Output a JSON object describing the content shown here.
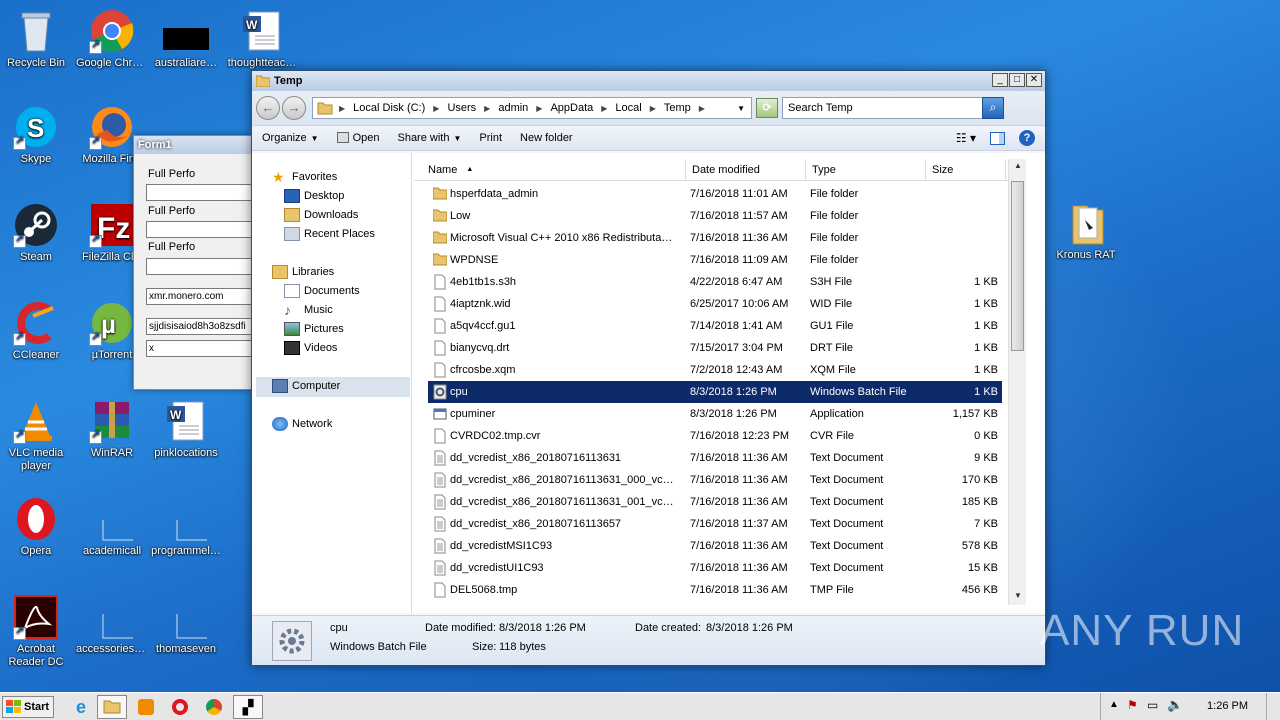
{
  "desktop": {
    "icons": [
      {
        "label": "Recycle Bin"
      },
      {
        "label": "Google Chrome"
      },
      {
        "label": "australiare…"
      },
      {
        "label": "thoughtteac…"
      },
      {
        "label": "Skype"
      },
      {
        "label": "Mozilla Firef"
      },
      {
        "label": "Steam"
      },
      {
        "label": "FileZilla Clie"
      },
      {
        "label": "CCleaner"
      },
      {
        "label": "µTorrent"
      },
      {
        "label": "VLC media player"
      },
      {
        "label": "WinRAR"
      },
      {
        "label": "pinklocations"
      },
      {
        "label": "Opera"
      },
      {
        "label": "academicall"
      },
      {
        "label": "programmel…"
      },
      {
        "label": "Acrobat Reader DC"
      },
      {
        "label": "accessoriesr…"
      },
      {
        "label": "thomaseven"
      },
      {
        "label": "Kronus RAT"
      }
    ]
  },
  "form1": {
    "title": "Form1",
    "labels": [
      "Full Perfo",
      "Full Perfo",
      "Full Perfo"
    ],
    "inputs": [
      "",
      "",
      "",
      "xmr.monero.com",
      "sjjdisisaiod8h3o8zsdfi",
      "x"
    ]
  },
  "explorer": {
    "title": "Temp",
    "breadcrumbs": [
      "Local Disk (C:)",
      "Users",
      "admin",
      "AppData",
      "Local",
      "Temp"
    ],
    "search_placeholder": "Search Temp",
    "commands": [
      "Organize",
      "Open",
      "Share with",
      "Print",
      "New folder"
    ],
    "nav": {
      "favorites": "Favorites",
      "desktop": "Desktop",
      "downloads": "Downloads",
      "recent": "Recent Places",
      "libraries": "Libraries",
      "documents": "Documents",
      "music": "Music",
      "pictures": "Pictures",
      "videos": "Videos",
      "computer": "Computer",
      "network": "Network"
    },
    "columns": {
      "name": "Name",
      "date": "Date modified",
      "type": "Type",
      "size": "Size"
    },
    "files": [
      {
        "name": "hsperfdata_admin",
        "date": "7/16/2018 11:01 AM",
        "type": "File folder",
        "size": "",
        "kind": "folder"
      },
      {
        "name": "Low",
        "date": "7/16/2018 11:57 AM",
        "type": "File folder",
        "size": "",
        "kind": "folder"
      },
      {
        "name": "Microsoft Visual C++ 2010  x86 Redistributa…",
        "date": "7/16/2018 11:36 AM",
        "type": "File folder",
        "size": "",
        "kind": "folder"
      },
      {
        "name": "WPDNSE",
        "date": "7/16/2018 11:09 AM",
        "type": "File folder",
        "size": "",
        "kind": "folder"
      },
      {
        "name": "4eb1tb1s.s3h",
        "date": "4/22/2018 6:47 AM",
        "type": "S3H File",
        "size": "1 KB",
        "kind": "file"
      },
      {
        "name": "4iaptznk.wid",
        "date": "6/25/2017 10:06 AM",
        "type": "WID File",
        "size": "1 KB",
        "kind": "file"
      },
      {
        "name": "a5qv4ccf.gu1",
        "date": "7/14/2018 1:41 AM",
        "type": "GU1 File",
        "size": "1 KB",
        "kind": "file"
      },
      {
        "name": "bianycvq.drt",
        "date": "7/15/2017 3:04 PM",
        "type": "DRT File",
        "size": "1 KB",
        "kind": "file"
      },
      {
        "name": "cfrcosbe.xqm",
        "date": "7/2/2018 12:43 AM",
        "type": "XQM File",
        "size": "1 KB",
        "kind": "file"
      },
      {
        "name": "cpu",
        "date": "8/3/2018 1:26 PM",
        "type": "Windows Batch File",
        "size": "1 KB",
        "kind": "batch",
        "selected": true
      },
      {
        "name": "cpuminer",
        "date": "8/3/2018 1:26 PM",
        "type": "Application",
        "size": "1,157 KB",
        "kind": "app"
      },
      {
        "name": "CVRDC02.tmp.cvr",
        "date": "7/16/2018 12:23 PM",
        "type": "CVR File",
        "size": "0 KB",
        "kind": "file"
      },
      {
        "name": "dd_vcredist_x86_20180716113631",
        "date": "7/16/2018 11:36 AM",
        "type": "Text Document",
        "size": "9 KB",
        "kind": "text"
      },
      {
        "name": "dd_vcredist_x86_20180716113631_000_vc…",
        "date": "7/16/2018 11:36 AM",
        "type": "Text Document",
        "size": "170 KB",
        "kind": "text"
      },
      {
        "name": "dd_vcredist_x86_20180716113631_001_vc…",
        "date": "7/16/2018 11:36 AM",
        "type": "Text Document",
        "size": "185 KB",
        "kind": "text"
      },
      {
        "name": "dd_vcredist_x86_20180716113657",
        "date": "7/16/2018 11:37 AM",
        "type": "Text Document",
        "size": "7 KB",
        "kind": "text"
      },
      {
        "name": "dd_vcredistMSI1C93",
        "date": "7/16/2018 11:36 AM",
        "type": "Text Document",
        "size": "578 KB",
        "kind": "text"
      },
      {
        "name": "dd_vcredistUI1C93",
        "date": "7/16/2018 11:36 AM",
        "type": "Text Document",
        "size": "15 KB",
        "kind": "text"
      },
      {
        "name": "DEL5068.tmp",
        "date": "7/16/2018 11:36 AM",
        "type": "TMP File",
        "size": "456 KB",
        "kind": "file"
      }
    ],
    "details": {
      "name": "cpu",
      "type": "Windows Batch File",
      "modified_label": "Date modified:",
      "modified": "8/3/2018 1:26 PM",
      "created_label": "Date created:",
      "created": "8/3/2018 1:26 PM",
      "size_label": "Size:",
      "size": "118 bytes"
    }
  },
  "taskbar": {
    "start": "Start",
    "clock": "1:26 PM"
  },
  "watermark": "ANY RUN"
}
